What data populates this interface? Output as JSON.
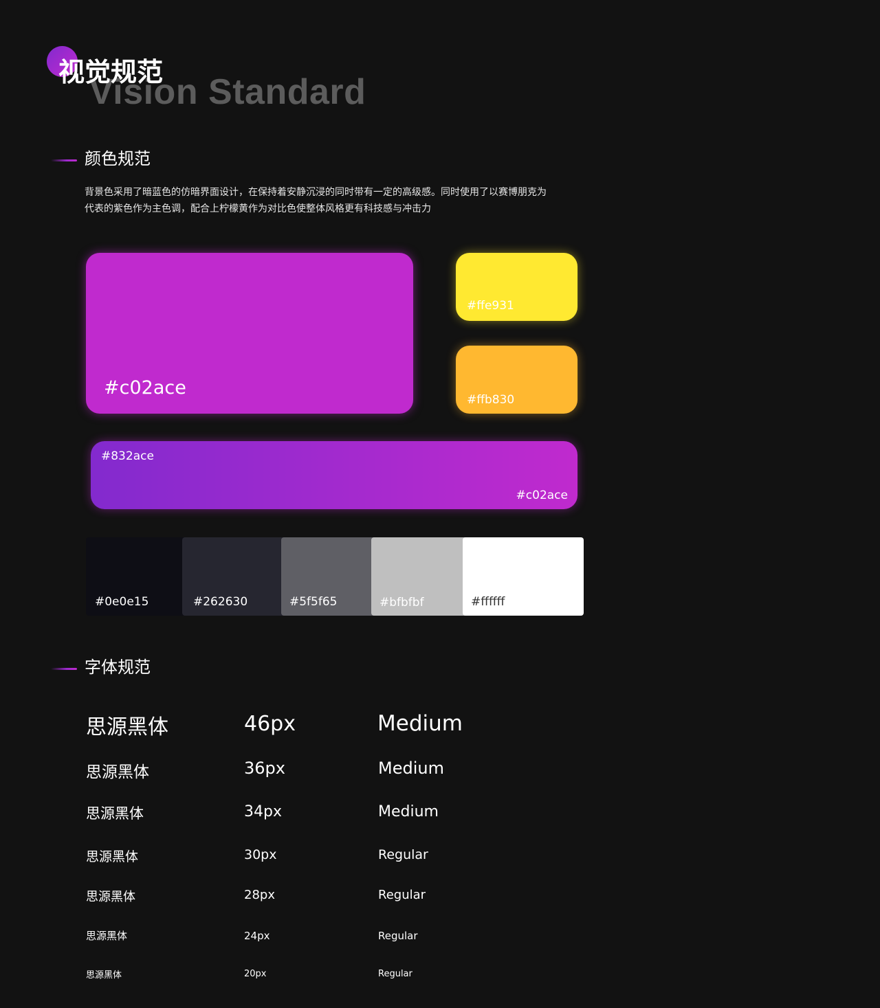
{
  "header": {
    "title_cn": "视觉规范",
    "title_en": "Vision Standard"
  },
  "color_section": {
    "title": "颜色规范",
    "description_line1": "背景色采用了暗蓝色的仿暗界面设计，在保持着安静沉浸的同时带有一定的高级感。同时使用了以赛博朋克为",
    "description_line2": "代表的紫色作为主色调，配合上柠檬黄作为对比色使整体风格更有科技感与冲击力",
    "primary": "#c02ace",
    "accent_yellow": "#ffe931",
    "accent_orange": "#ffb830",
    "gradient_start": "#832ace",
    "gradient_end": "#c02ace",
    "neutrals": [
      "#0e0e15",
      "#262630",
      "#5f5f65",
      "#bfbfbf",
      "#ffffff"
    ]
  },
  "font_section": {
    "title": "字体规范",
    "rows": [
      {
        "font": "思源黑体",
        "size": "46px",
        "weight": "Medium"
      },
      {
        "font": "思源黑体",
        "size": "36px",
        "weight": "Medium"
      },
      {
        "font": "思源黑体",
        "size": "34px",
        "weight": "Medium"
      },
      {
        "font": "思源黑体",
        "size": "30px",
        "weight": "Regular"
      },
      {
        "font": "思源黑体",
        "size": "28px",
        "weight": "Regular"
      },
      {
        "font": "思源黑体",
        "size": "24px",
        "weight": "Regular"
      },
      {
        "font": "思源黑体",
        "size": "20px",
        "weight": "Regular"
      }
    ]
  }
}
